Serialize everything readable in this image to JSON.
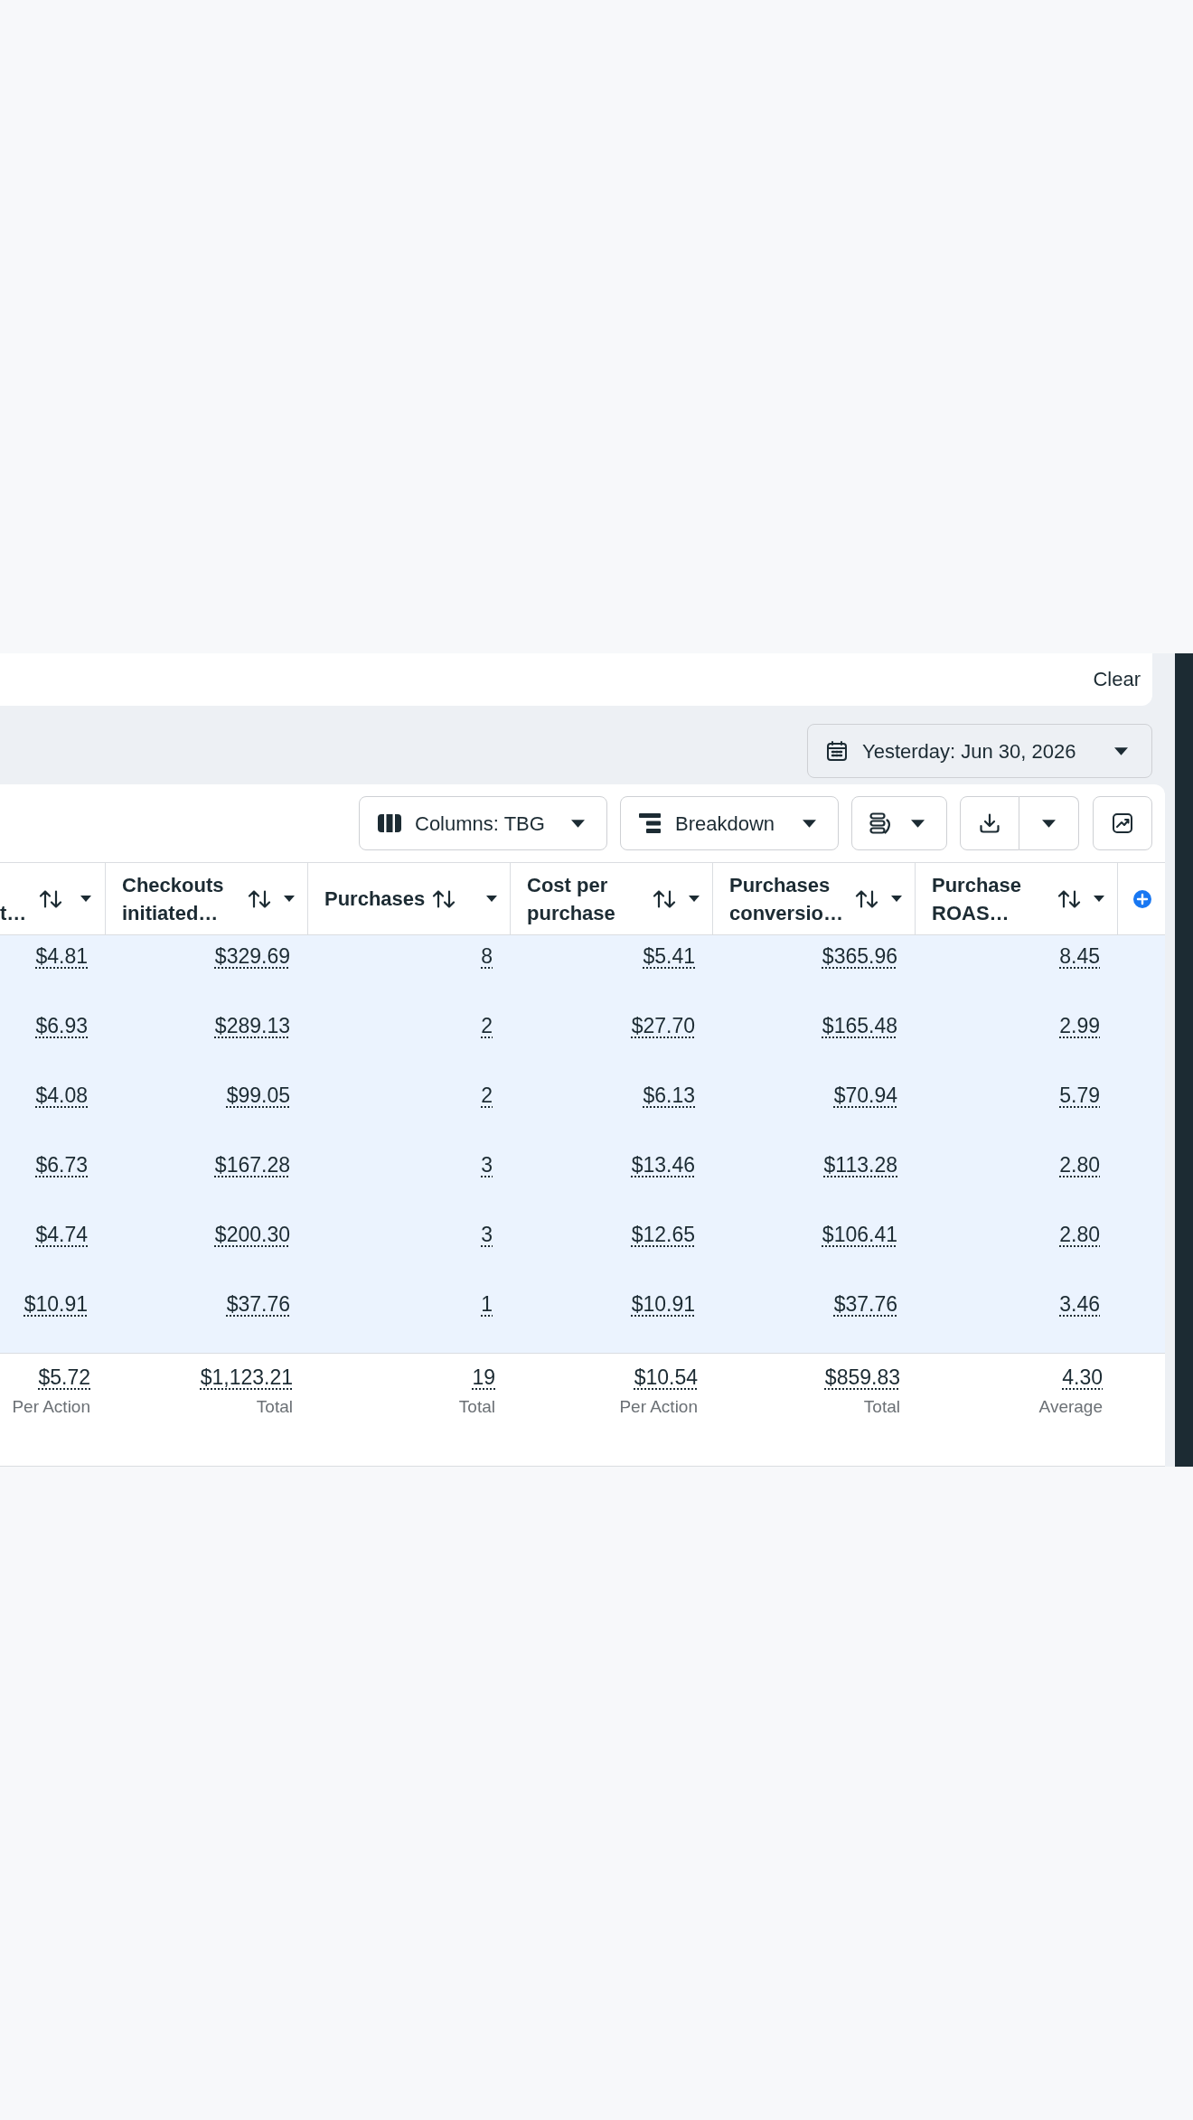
{
  "filter_bar": {
    "clear_button": "Clear"
  },
  "date_picker": {
    "label": "Yesterday: Jun 30, 2026"
  },
  "toolbar": {
    "columns_button": "Columns: TBG",
    "breakdown_button": "Breakdown"
  },
  "table": {
    "columns": [
      {
        "kind": "partial",
        "label": "t…"
      },
      {
        "kind": "metric",
        "label": "Checkouts initiated…"
      },
      {
        "kind": "metric",
        "label": "Purchases"
      },
      {
        "kind": "metric",
        "label": "Cost per purchase"
      },
      {
        "kind": "metric",
        "label": "Purchases conversio…"
      },
      {
        "kind": "metric",
        "label": "Purchase ROAS…"
      },
      {
        "kind": "add"
      }
    ],
    "rows": [
      {
        "selected": true,
        "cells": [
          "$4.81",
          "$329.69",
          "8",
          "$5.41",
          "$365.96",
          "8.45"
        ]
      },
      {
        "selected": true,
        "cells": [
          "$6.93",
          "$289.13",
          "2",
          "$27.70",
          "$165.48",
          "2.99"
        ]
      },
      {
        "selected": true,
        "cells": [
          "$4.08",
          "$99.05",
          "2",
          "$6.13",
          "$70.94",
          "5.79"
        ]
      },
      {
        "selected": true,
        "cells": [
          "$6.73",
          "$167.28",
          "3",
          "$13.46",
          "$113.28",
          "2.80"
        ]
      },
      {
        "selected": true,
        "cells": [
          "$4.74",
          "$200.30",
          "3",
          "$12.65",
          "$106.41",
          "2.80"
        ]
      },
      {
        "selected": true,
        "cells": [
          "$10.91",
          "$37.76",
          "1",
          "$10.91",
          "$37.76",
          "3.46"
        ]
      }
    ],
    "totals": [
      {
        "value": "$5.72",
        "caption": "Per Action"
      },
      {
        "value": "$1,123.21",
        "caption": "Total"
      },
      {
        "value": "19",
        "caption": "Total"
      },
      {
        "value": "$10.54",
        "caption": "Per Action"
      },
      {
        "value": "$859.83",
        "caption": "Total"
      },
      {
        "value": "4.30",
        "caption": "Average"
      }
    ]
  }
}
